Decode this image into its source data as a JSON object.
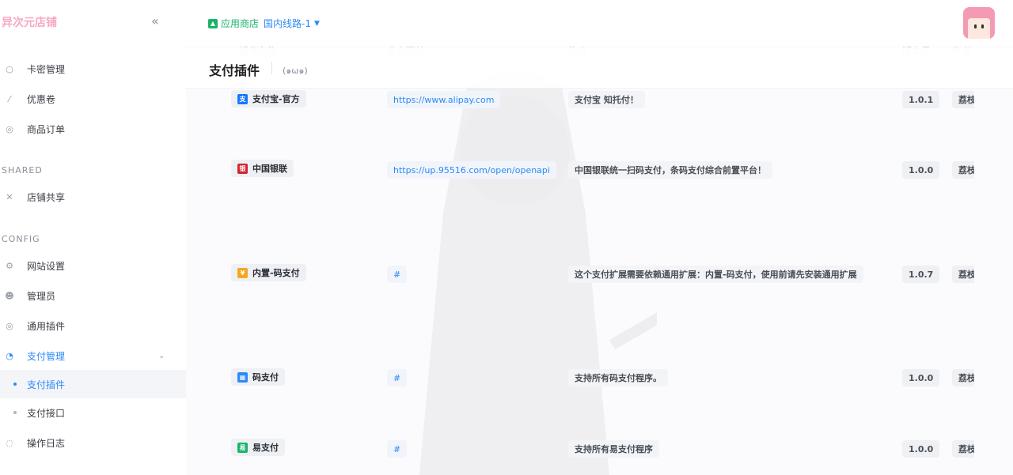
{
  "brand": "异次元店铺",
  "sidebar": {
    "groups": [
      {
        "label": "",
        "items": [
          {
            "label": "卡密管理",
            "icon": "key-icon"
          },
          {
            "label": "优惠卷",
            "icon": "coupon-icon"
          },
          {
            "label": "商品订单",
            "icon": "order-icon"
          }
        ]
      },
      {
        "label": "SHARED",
        "items": [
          {
            "label": "店铺共享",
            "icon": "share-icon"
          }
        ]
      },
      {
        "label": "CONFIG",
        "items": [
          {
            "label": "网站设置",
            "icon": "gear-icon"
          },
          {
            "label": "管理员",
            "icon": "users-icon"
          },
          {
            "label": "通用插件",
            "icon": "plugin-icon"
          },
          {
            "label": "支付管理",
            "icon": "payment-icon"
          }
        ]
      }
    ],
    "sub_items": [
      {
        "label": "支付插件",
        "active": true
      },
      {
        "label": "支付接口",
        "active": false
      }
    ],
    "last_item": {
      "label": "操作日志",
      "icon": "log-icon"
    }
  },
  "topbar": {
    "store_label": "应用商店",
    "route_label": "国内线路-1"
  },
  "page": {
    "title": "支付插件",
    "emote": "(๑ω๑)"
  },
  "table": {
    "columns": [
      "插件名称",
      "官方网站",
      "简介",
      "版本号",
      "作者"
    ],
    "rows": [
      {
        "name": "支付宝-官方",
        "icon_color": "#1677ff",
        "url": "https://www.alipay.com",
        "desc": "支付宝 知托付！",
        "version": "1.0.1",
        "author": "荔枝"
      },
      {
        "name": "中国银联",
        "icon_color": "#d4232f",
        "url": "https://up.95516.com/open/openapi",
        "desc": "中国银联统一扫码支付，条码支付综合前置平台！",
        "version": "1.0.0",
        "author": "荔枝"
      },
      {
        "name": "内置-码支付",
        "icon_color": "#f5a623",
        "url": "#",
        "desc": "这个支付扩展需要依赖通用扩展：内置-码支付，使用前请先安装通用扩展",
        "version": "1.0.7",
        "author": "荔枝"
      },
      {
        "name": "码支付",
        "icon_color": "#2b8af7",
        "url": "#",
        "desc": "支持所有码支付程序。",
        "version": "1.0.0",
        "author": "荔枝"
      },
      {
        "name": "易支付",
        "icon_color": "#19b36b",
        "url": "#",
        "desc": "支持所有易支付程序",
        "version": "1.0.0",
        "author": "荔枝"
      }
    ]
  }
}
